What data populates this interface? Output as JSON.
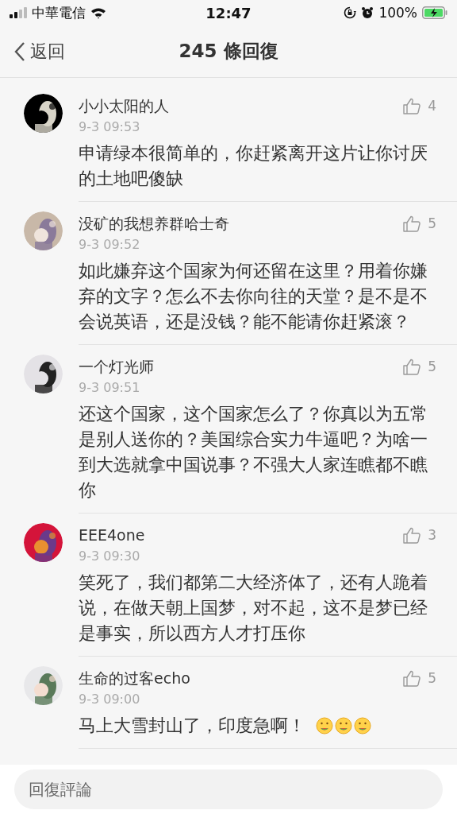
{
  "status_bar": {
    "carrier": "中華電信",
    "time": "12:47",
    "battery": "100%"
  },
  "nav": {
    "back": "返回",
    "title": "245 條回復"
  },
  "comments": [
    {
      "name": "小小太阳的人",
      "vip": false,
      "time": "9-3 09:53",
      "text": "申请绿本很简单的，你赶紧离开这片让你讨厌的土地吧傻缺",
      "likes": "4"
    },
    {
      "name": "没矿的我想养群哈士奇",
      "vip": false,
      "time": "9-3 09:52",
      "text": "如此嫌弃这个国家为何还留在这里？用着你嫌弃的文字？怎么不去你向往的天堂？是不是不会说英语，还是没钱？能不能请你赶紧滚？",
      "likes": "5"
    },
    {
      "name": "一个灯光师",
      "vip": false,
      "time": "9-3 09:51",
      "text": "还这个国家，这个国家怎么了？你真以为五常是别人送你的？美国综合实力牛逼吧？为啥一到大选就拿中国说事？不强大人家连瞧都不瞧你",
      "likes": "5"
    },
    {
      "name": "EEE4one",
      "vip": false,
      "time": "9-3 09:30",
      "text": "笑死了，我们都第二大经济体了，还有人跪着说，在做天朝上国梦，对不起，这不是梦已经是事实，所以西方人才打压你",
      "likes": "3"
    },
    {
      "name": "生命的过客echo",
      "vip": false,
      "time": "9-3 09:00",
      "text": "马上大雪封山了，印度急啊！",
      "emojis": [
        {
          "kind": "face"
        },
        {
          "kind": "face"
        },
        {
          "kind": "face"
        }
      ],
      "likes": "5"
    }
  ],
  "reply_field": {
    "placeholder": "回復評論"
  }
}
